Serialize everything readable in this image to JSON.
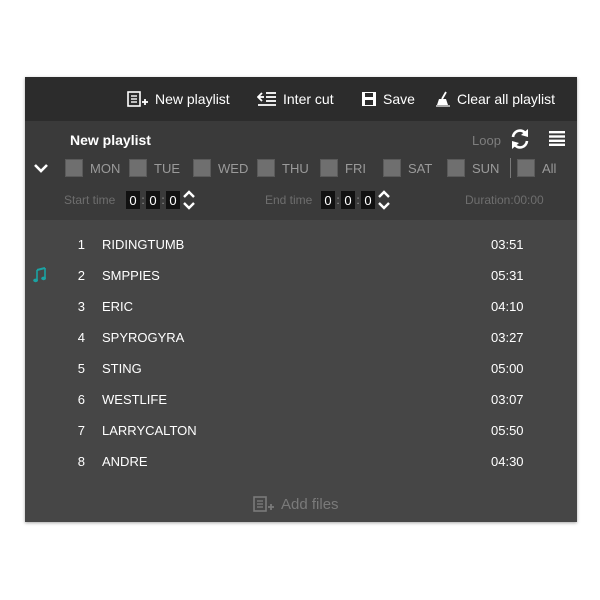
{
  "toolbar": {
    "new_playlist": "New playlist",
    "inter_cut": "Inter cut",
    "save": "Save",
    "clear_all": "Clear all playlist"
  },
  "playlist": {
    "title": "New playlist",
    "loop_label": "Loop",
    "days": [
      {
        "label": "MON",
        "checked": false
      },
      {
        "label": "TUE",
        "checked": false
      },
      {
        "label": "WED",
        "checked": false
      },
      {
        "label": "THU",
        "checked": false
      },
      {
        "label": "FRI",
        "checked": false
      },
      {
        "label": "SAT",
        "checked": false
      },
      {
        "label": "SUN",
        "checked": false
      },
      {
        "label": "All",
        "checked": false
      }
    ],
    "start_time_label": "Start time",
    "start_time": [
      "0",
      "0",
      "0"
    ],
    "end_time_label": "End time",
    "end_time": [
      "0",
      "0",
      "0"
    ],
    "duration": "Duration:00:00"
  },
  "tracks": [
    {
      "num": "1",
      "name": "RIDINGTUMB",
      "duration": "03:51",
      "playing": false
    },
    {
      "num": "2",
      "name": "SMPPIES",
      "duration": "05:31",
      "playing": true
    },
    {
      "num": "3",
      "name": "ERIC",
      "duration": "04:10",
      "playing": false
    },
    {
      "num": "4",
      "name": "SPYROGYRA",
      "duration": "03:27",
      "playing": false
    },
    {
      "num": "5",
      "name": "STING",
      "duration": "05:00",
      "playing": false
    },
    {
      "num": "6",
      "name": "WESTLIFE",
      "duration": "03:07",
      "playing": false
    },
    {
      "num": "7",
      "name": "LARRYCALTON",
      "duration": "05:50",
      "playing": false
    },
    {
      "num": "8",
      "name": "ANDRE",
      "duration": "04:30",
      "playing": false
    }
  ],
  "add_files_label": "Add files",
  "colors": {
    "toolbar_bg": "#2c2c2c",
    "header_bg": "#3a3a3a",
    "list_bg": "#464646",
    "playing_accent": "#1aa3a3"
  }
}
